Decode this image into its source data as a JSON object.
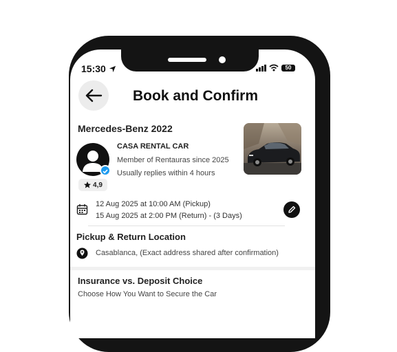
{
  "status_bar": {
    "time": "15:30",
    "battery": "50"
  },
  "header": {
    "title": "Book and Confirm"
  },
  "car": {
    "name": "Mercedes-Benz 2022"
  },
  "host": {
    "company": "CASA RENTAL CAR",
    "member_since": "Member of Rentauras since 2025",
    "reply_time": "Usually replies within 4 hours",
    "rating": "4,9"
  },
  "dates": {
    "pickup": "12 Aug 2025 at 10:00 AM (Pickup)",
    "return": "15 Aug 2025 at 2:00 PM (Return) - (3 Days)"
  },
  "location": {
    "title": "Pickup & Return Location",
    "text": "Casablanca, (Exact address shared after confirmation)"
  },
  "insurance": {
    "title": "Insurance vs. Deposit Choice",
    "subtitle": "Choose How You Want to Secure the Car"
  },
  "colors": {
    "verified": "#1d9bf0",
    "frame": "#141414"
  },
  "icons": [
    "location-arrow-icon",
    "signal-icon",
    "wifi-icon",
    "battery-icon",
    "back-arrow-icon",
    "star-icon",
    "verified-check-icon",
    "calendar-icon",
    "pencil-icon",
    "map-pin-icon"
  ]
}
